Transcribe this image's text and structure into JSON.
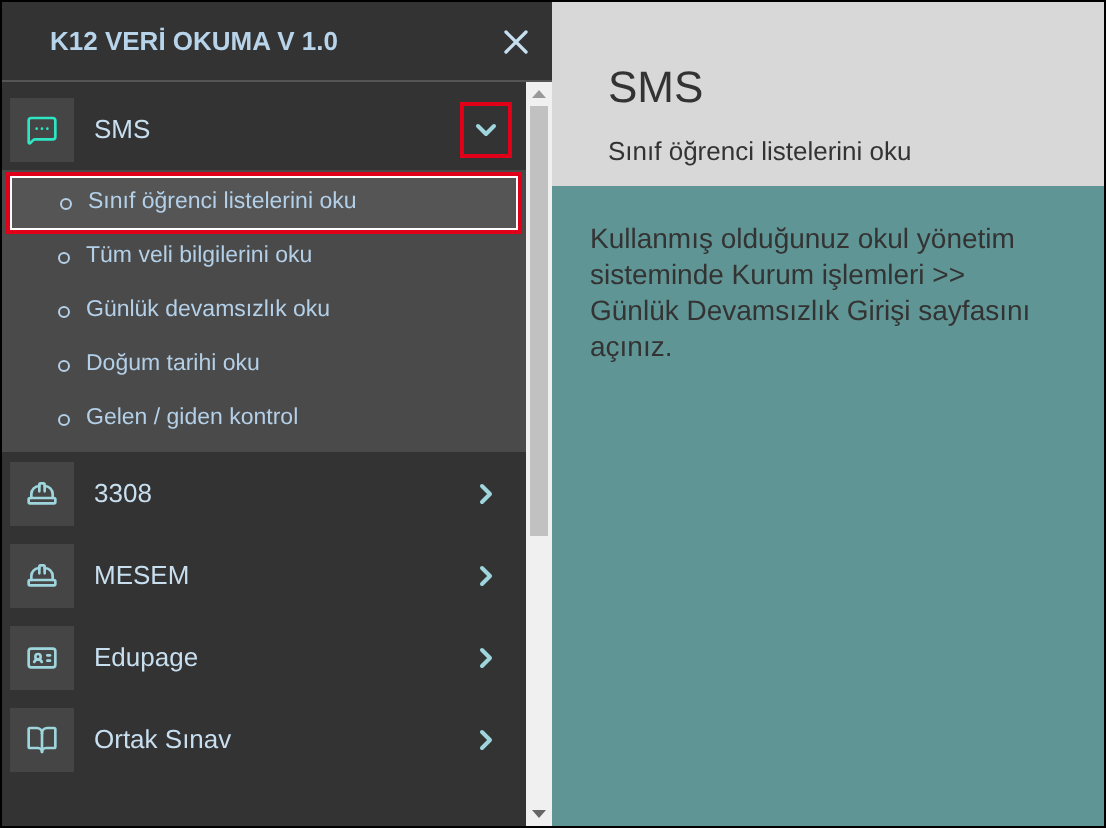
{
  "sidebar": {
    "title": "K12 VERİ OKUMA V 1.0",
    "items": [
      {
        "label": "SMS",
        "kind": "chat",
        "expanded": true,
        "highlighted": true,
        "children": [
          {
            "label": "Sınıf öğrenci listelerini oku",
            "selected": true,
            "highlighted": true
          },
          {
            "label": "Tüm veli bilgilerini oku",
            "selected": false,
            "highlighted": false
          },
          {
            "label": "Günlük devamsızlık oku",
            "selected": false,
            "highlighted": false
          },
          {
            "label": "Doğum tarihi oku",
            "selected": false,
            "highlighted": false
          },
          {
            "label": "Gelen / giden kontrol",
            "selected": false,
            "highlighted": false
          }
        ]
      },
      {
        "label": "3308",
        "kind": "worker",
        "expanded": false,
        "highlighted": false
      },
      {
        "label": "MESEM",
        "kind": "worker",
        "expanded": false,
        "highlighted": false
      },
      {
        "label": "Edupage",
        "kind": "card",
        "expanded": false,
        "highlighted": false
      },
      {
        "label": "Ortak Sınav",
        "kind": "book",
        "expanded": false,
        "highlighted": false
      }
    ]
  },
  "header": {
    "title": "SMS",
    "subtitle": "Sınıf öğrenci listelerini oku"
  },
  "content": {
    "text": "Kullanmış olduğunuz okul yönetim sisteminde Kurum işlemleri >> Günlük Devamsızlık Girişi sayfasını açınız."
  }
}
